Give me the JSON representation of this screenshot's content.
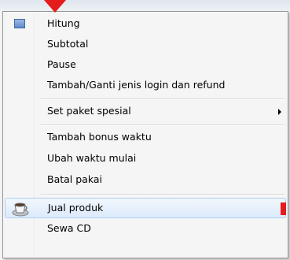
{
  "menu": {
    "items": [
      {
        "label": "Hitung",
        "icon": "calculator-icon"
      },
      {
        "label": "Subtotal"
      },
      {
        "label": "Pause"
      },
      {
        "label": "Tambah/Ganti jenis login dan refund"
      },
      {
        "label": "Set paket spesial",
        "submenu": true
      },
      {
        "label": "Tambah bonus waktu"
      },
      {
        "label": "Ubah waktu mulai"
      },
      {
        "label": "Batal pakai"
      },
      {
        "label": "Jual produk",
        "icon": "coffee-cup-icon",
        "selected": true
      },
      {
        "label": "Sewa CD"
      }
    ]
  },
  "colors": {
    "annotation_red": "#e51c1c",
    "highlight_border": "#aecff7",
    "menu_background": "#f5f5f5"
  }
}
